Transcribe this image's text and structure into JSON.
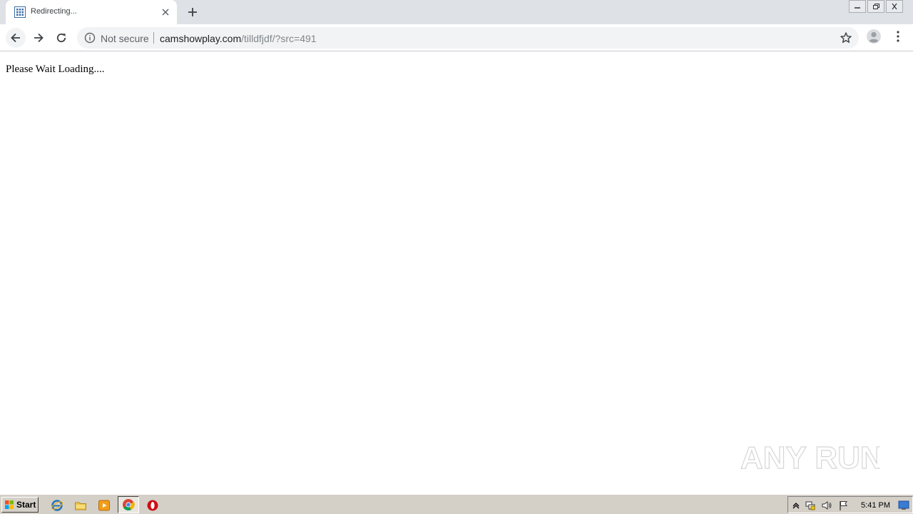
{
  "browser": {
    "tab": {
      "title": "Redirecting..."
    },
    "omnibox": {
      "security_label": "Not secure",
      "url_host": "camshowplay.com",
      "url_path": "/tilldfjdf/?src=491"
    }
  },
  "page": {
    "text": "Please Wait Loading...."
  },
  "watermark": {
    "text": "ANY RUN"
  },
  "taskbar": {
    "start_label": "Start",
    "clock": "5:41 PM"
  },
  "colors": {
    "tabstrip": "#dee1e6",
    "omnibox_bg": "#f1f3f4",
    "taskbar": "#d4d0c8"
  }
}
